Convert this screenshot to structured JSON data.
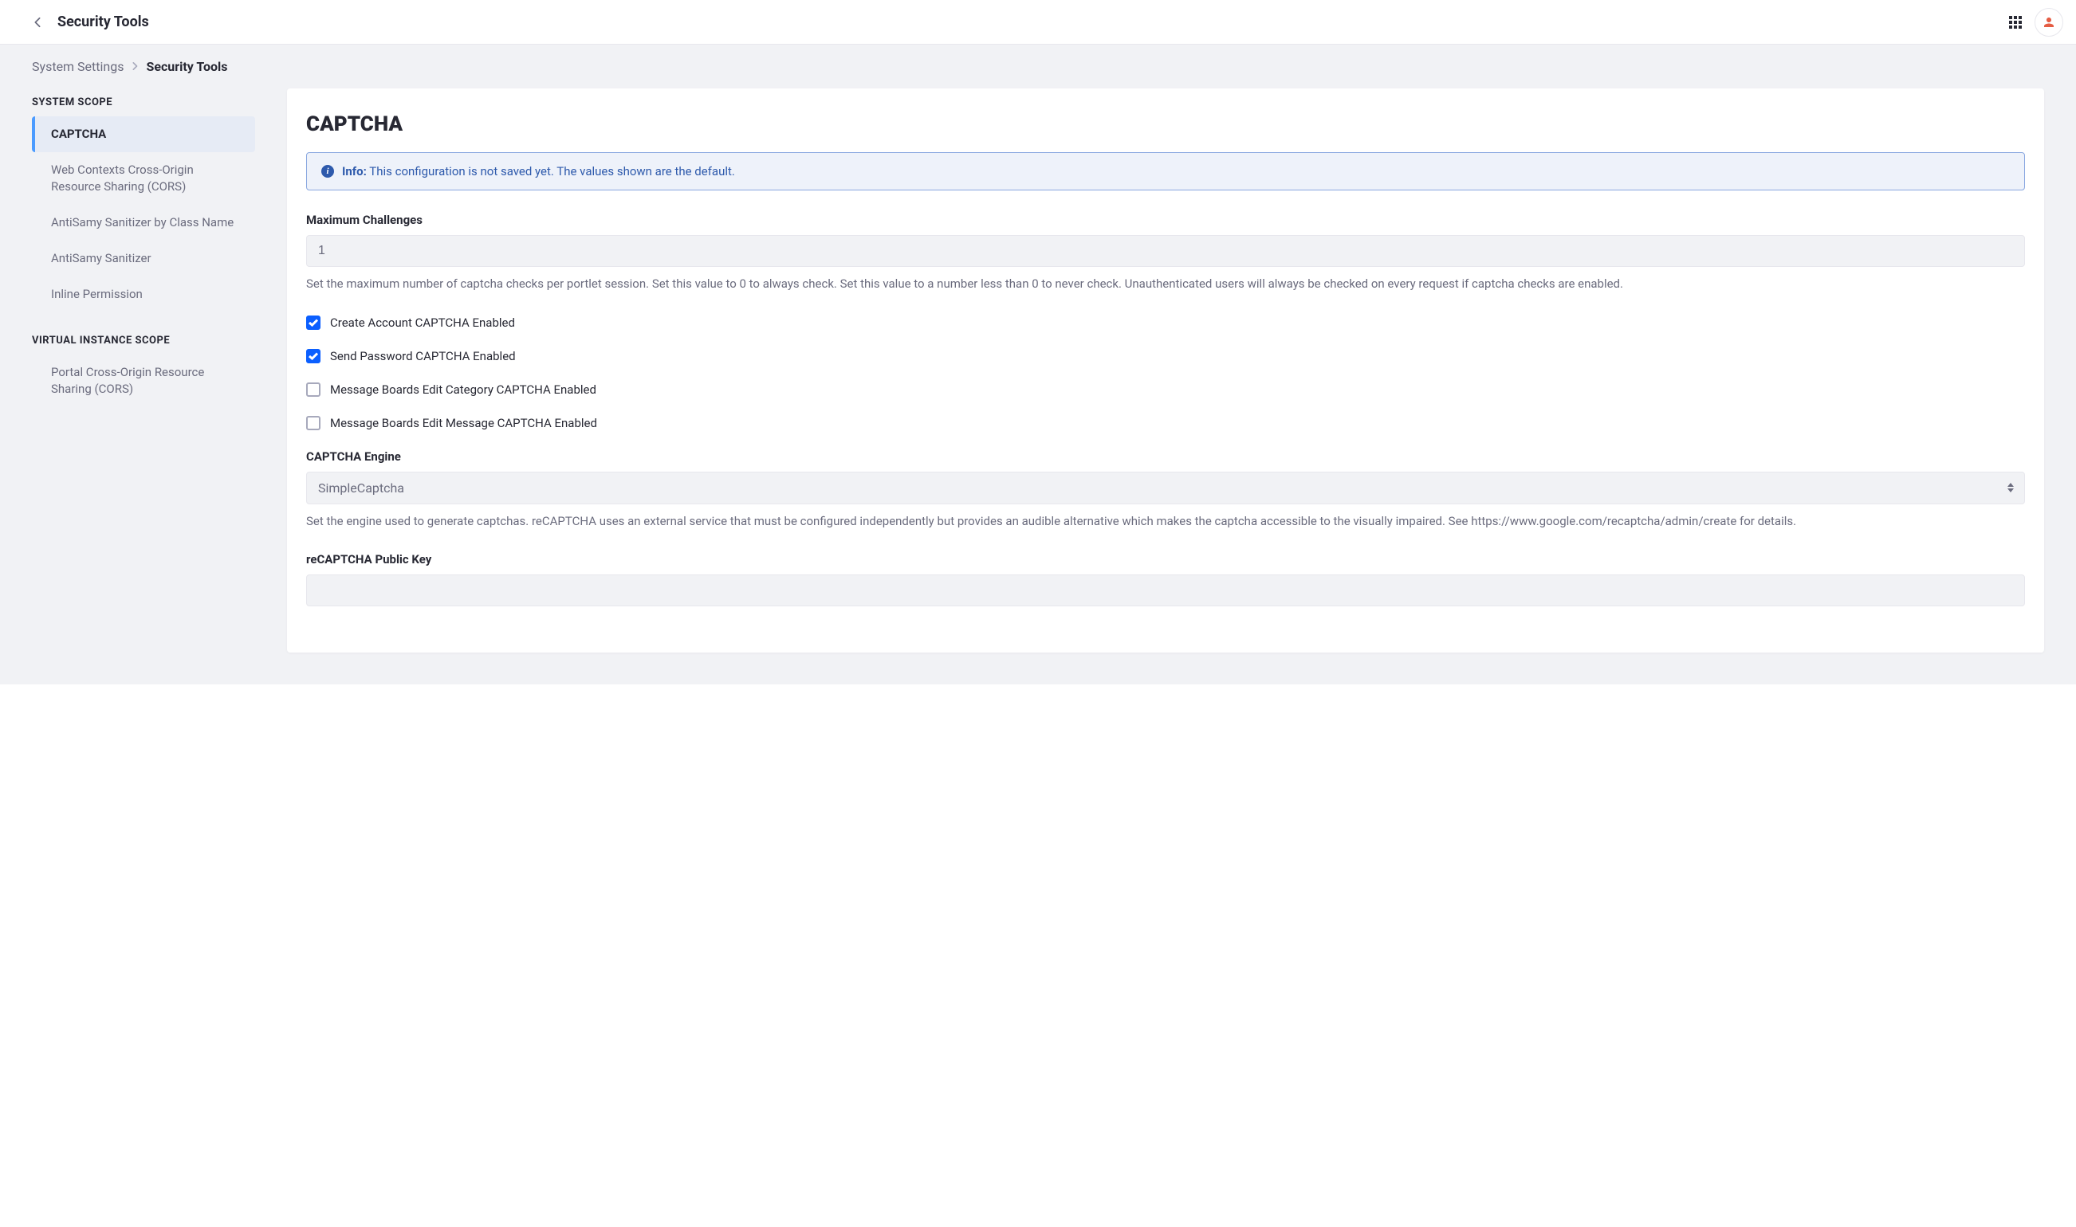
{
  "header": {
    "title": "Security Tools"
  },
  "breadcrumb": {
    "parent": "System Settings",
    "current": "Security Tools"
  },
  "sidebar": {
    "groups": [
      {
        "title": "SYSTEM SCOPE",
        "items": [
          {
            "label": "CAPTCHA",
            "active": true
          },
          {
            "label": "Web Contexts Cross-Origin Resource Sharing (CORS)",
            "active": false
          },
          {
            "label": "AntiSamy Sanitizer by Class Name",
            "active": false
          },
          {
            "label": "AntiSamy Sanitizer",
            "active": false
          },
          {
            "label": "Inline Permission",
            "active": false
          }
        ]
      },
      {
        "title": "VIRTUAL INSTANCE SCOPE",
        "items": [
          {
            "label": "Portal Cross-Origin Resource Sharing (CORS)",
            "active": false
          }
        ]
      }
    ]
  },
  "main": {
    "title": "CAPTCHA",
    "alert": {
      "label": "Info:",
      "text": "This configuration is not saved yet. The values shown are the default."
    },
    "fields": {
      "max_challenges": {
        "label": "Maximum Challenges",
        "value": "1",
        "help": "Set the maximum number of captcha checks per portlet session. Set this value to 0 to always check. Set this value to a number less than 0 to never check. Unauthenticated users will always be checked on every request if captcha checks are enabled."
      },
      "checkboxes": [
        {
          "label": "Create Account CAPTCHA Enabled",
          "checked": true
        },
        {
          "label": "Send Password CAPTCHA Enabled",
          "checked": true
        },
        {
          "label": "Message Boards Edit Category CAPTCHA Enabled",
          "checked": false
        },
        {
          "label": "Message Boards Edit Message CAPTCHA Enabled",
          "checked": false
        }
      ],
      "engine": {
        "label": "CAPTCHA Engine",
        "value": "SimpleCaptcha",
        "help": "Set the engine used to generate captchas. reCAPTCHA uses an external service that must be configured independently but provides an audible alternative which makes the captcha accessible to the visually impaired. See https://www.google.com/recaptcha/admin/create for details."
      },
      "recaptcha_public": {
        "label": "reCAPTCHA Public Key",
        "value": ""
      }
    }
  }
}
